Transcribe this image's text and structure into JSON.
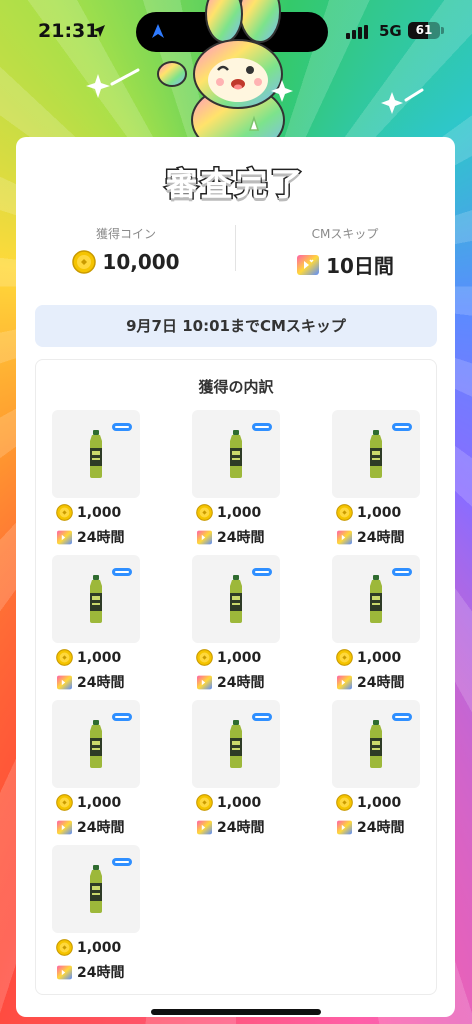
{
  "status_bar": {
    "time": "21:31",
    "network": "5G",
    "battery": "61"
  },
  "card": {
    "title": "審査完了",
    "stats": [
      {
        "label": "獲得コイン",
        "value": "10,000",
        "icon": "coin-icon"
      },
      {
        "label": "CMスキップ",
        "value": "10日間",
        "icon": "cm-skip-icon"
      }
    ],
    "skip_until": "9月7日 10:01までCMスキップ",
    "breakdown": {
      "title": "獲得の内訳",
      "items": [
        {
          "coins": "1,000",
          "skip": "24時間",
          "image": "green-tea-bottle"
        },
        {
          "coins": "1,000",
          "skip": "24時間",
          "image": "green-tea-bottle"
        },
        {
          "coins": "1,000",
          "skip": "24時間",
          "image": "green-tea-bottle"
        },
        {
          "coins": "1,000",
          "skip": "24時間",
          "image": "green-tea-bottle"
        },
        {
          "coins": "1,000",
          "skip": "24時間",
          "image": "green-tea-bottle"
        },
        {
          "coins": "1,000",
          "skip": "24時間",
          "image": "green-tea-bottle"
        },
        {
          "coins": "1,000",
          "skip": "24時間",
          "image": "green-tea-bottle"
        },
        {
          "coins": "1,000",
          "skip": "24時間",
          "image": "green-tea-bottle"
        },
        {
          "coins": "1,000",
          "skip": "24時間",
          "image": "green-tea-bottle"
        },
        {
          "coins": "1,000",
          "skip": "24時間",
          "image": "green-tea-bottle"
        }
      ]
    }
  },
  "colors": {
    "coin": "#f5c400",
    "banner": "#e6eefb",
    "card": "#ffffff"
  }
}
